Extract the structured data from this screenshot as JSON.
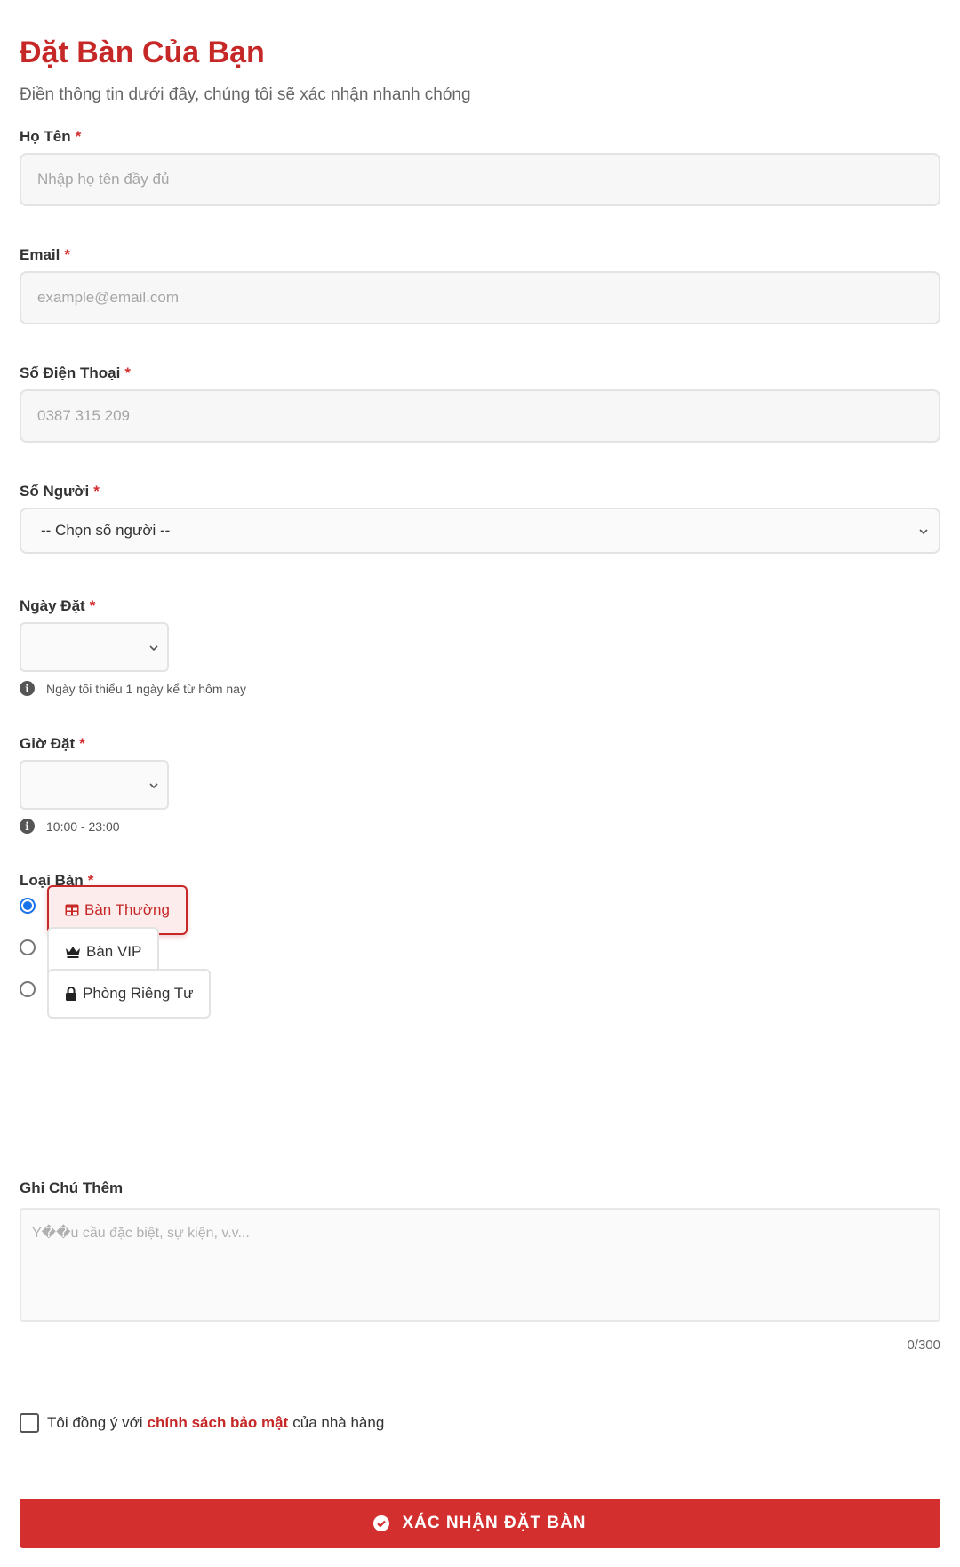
{
  "header": {
    "title": "Đặt Bàn Của Bạn",
    "subtitle": "Điền thông tin dưới đây, chúng tôi sẽ xác nhận nhanh chóng"
  },
  "required_mark": "*",
  "fields": {
    "name": {
      "label": "Họ Tên",
      "placeholder": "Nhập họ tên đầy đủ",
      "value": ""
    },
    "email": {
      "label": "Email",
      "placeholder": "example@email.com",
      "value": ""
    },
    "phone": {
      "label": "Số Điện Thoại",
      "placeholder": "0387 315 209",
      "value": ""
    },
    "guests": {
      "label": "Số Người",
      "selected": "-- Chọn số người --"
    },
    "date": {
      "label": "Ngày Đặt",
      "selected": "",
      "hint": "Ngày tối thiểu 1 ngày kể từ hôm nay"
    },
    "time": {
      "label": "Giờ Đặt",
      "selected": "",
      "hint": "10:00 - 23:00"
    },
    "table_type": {
      "label": "Loại Bàn",
      "options": [
        {
          "label": "Bàn Thường",
          "icon": "table-icon",
          "selected": true
        },
        {
          "label": "Bàn VIP",
          "icon": "crown-icon",
          "selected": false
        },
        {
          "label": "Phòng Riêng Tư",
          "icon": "lock-icon",
          "selected": false
        }
      ]
    },
    "notes": {
      "label": "Ghi Chú Thêm",
      "placeholder": "Y��u cầu đặc biệt, sự kiện, v.v...",
      "counter": "0/300"
    }
  },
  "agreement": {
    "prefix": "Tôi đồng ý với",
    "link": "chính sách bảo mật",
    "suffix": "của nhà hàng",
    "checked": false
  },
  "submit": {
    "label": "XÁC NHẬN ĐẶT BÀN",
    "icon": "check-circle-icon"
  },
  "colors": {
    "accent": "#d32f2f",
    "title": "#c62828",
    "radio": "#1a73e8"
  }
}
